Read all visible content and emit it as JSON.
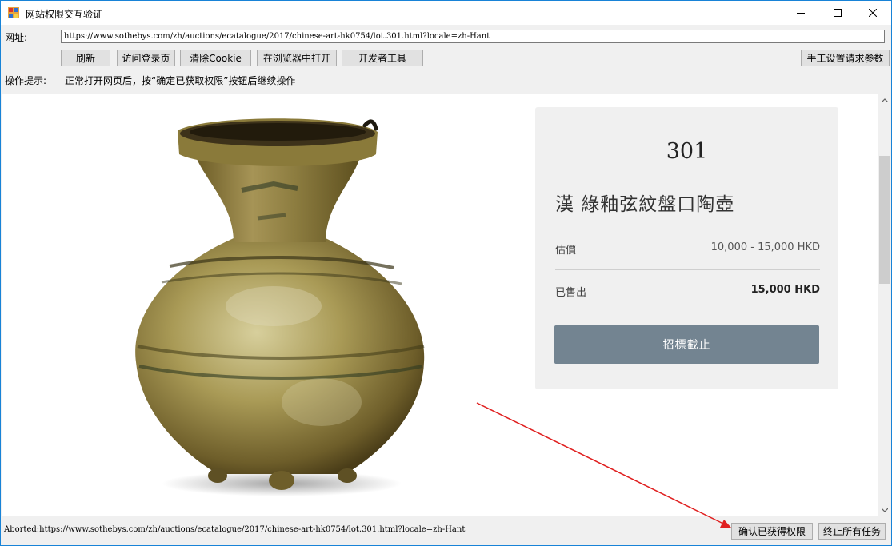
{
  "window": {
    "title": "网站权限交互验证",
    "icons": {
      "app": "app-icon",
      "minimize": "minimize-icon",
      "maximize": "maximize-icon",
      "close": "close-icon"
    }
  },
  "form": {
    "url_label": "网址:",
    "url_value": "https://www.sothebys.com/zh/auctions/ecatalogue/2017/chinese-art-hk0754/lot.301.html?locale=zh-Hant",
    "buttons": {
      "refresh": "刷新",
      "visit_login": "访问登录页",
      "clear_cookie": "清除Cookie",
      "open_in_browser": "在浏览器中打开",
      "dev_tools": "开发者工具",
      "manual_params": "手工设置请求参数"
    },
    "hint_label": "操作提示:",
    "hint_text": "正常打开网页后，按“确定已获取权限”按钮后继续操作"
  },
  "page": {
    "lot": {
      "number": "301",
      "title": "漢 綠釉弦紋盤口陶壺",
      "estimate_label": "估價",
      "estimate_value": "10,000 - 15,000 HKD",
      "sold_label": "已售出",
      "sold_value": "15,000 HKD",
      "bid_button": "招標截止"
    },
    "image": "green-glazed-pottery-jar"
  },
  "footer": {
    "status": "Aborted:https://www.sothebys.com/zh/auctions/ecatalogue/2017/chinese-art-hk0754/lot.301.html?locale=zh-Hant",
    "confirm_button": "确认已获得权限",
    "stop_button": "终止所有任务"
  },
  "colors": {
    "title_border": "#1883d7",
    "bid_button": "#738491",
    "annotation_arrow": "#e02020"
  }
}
